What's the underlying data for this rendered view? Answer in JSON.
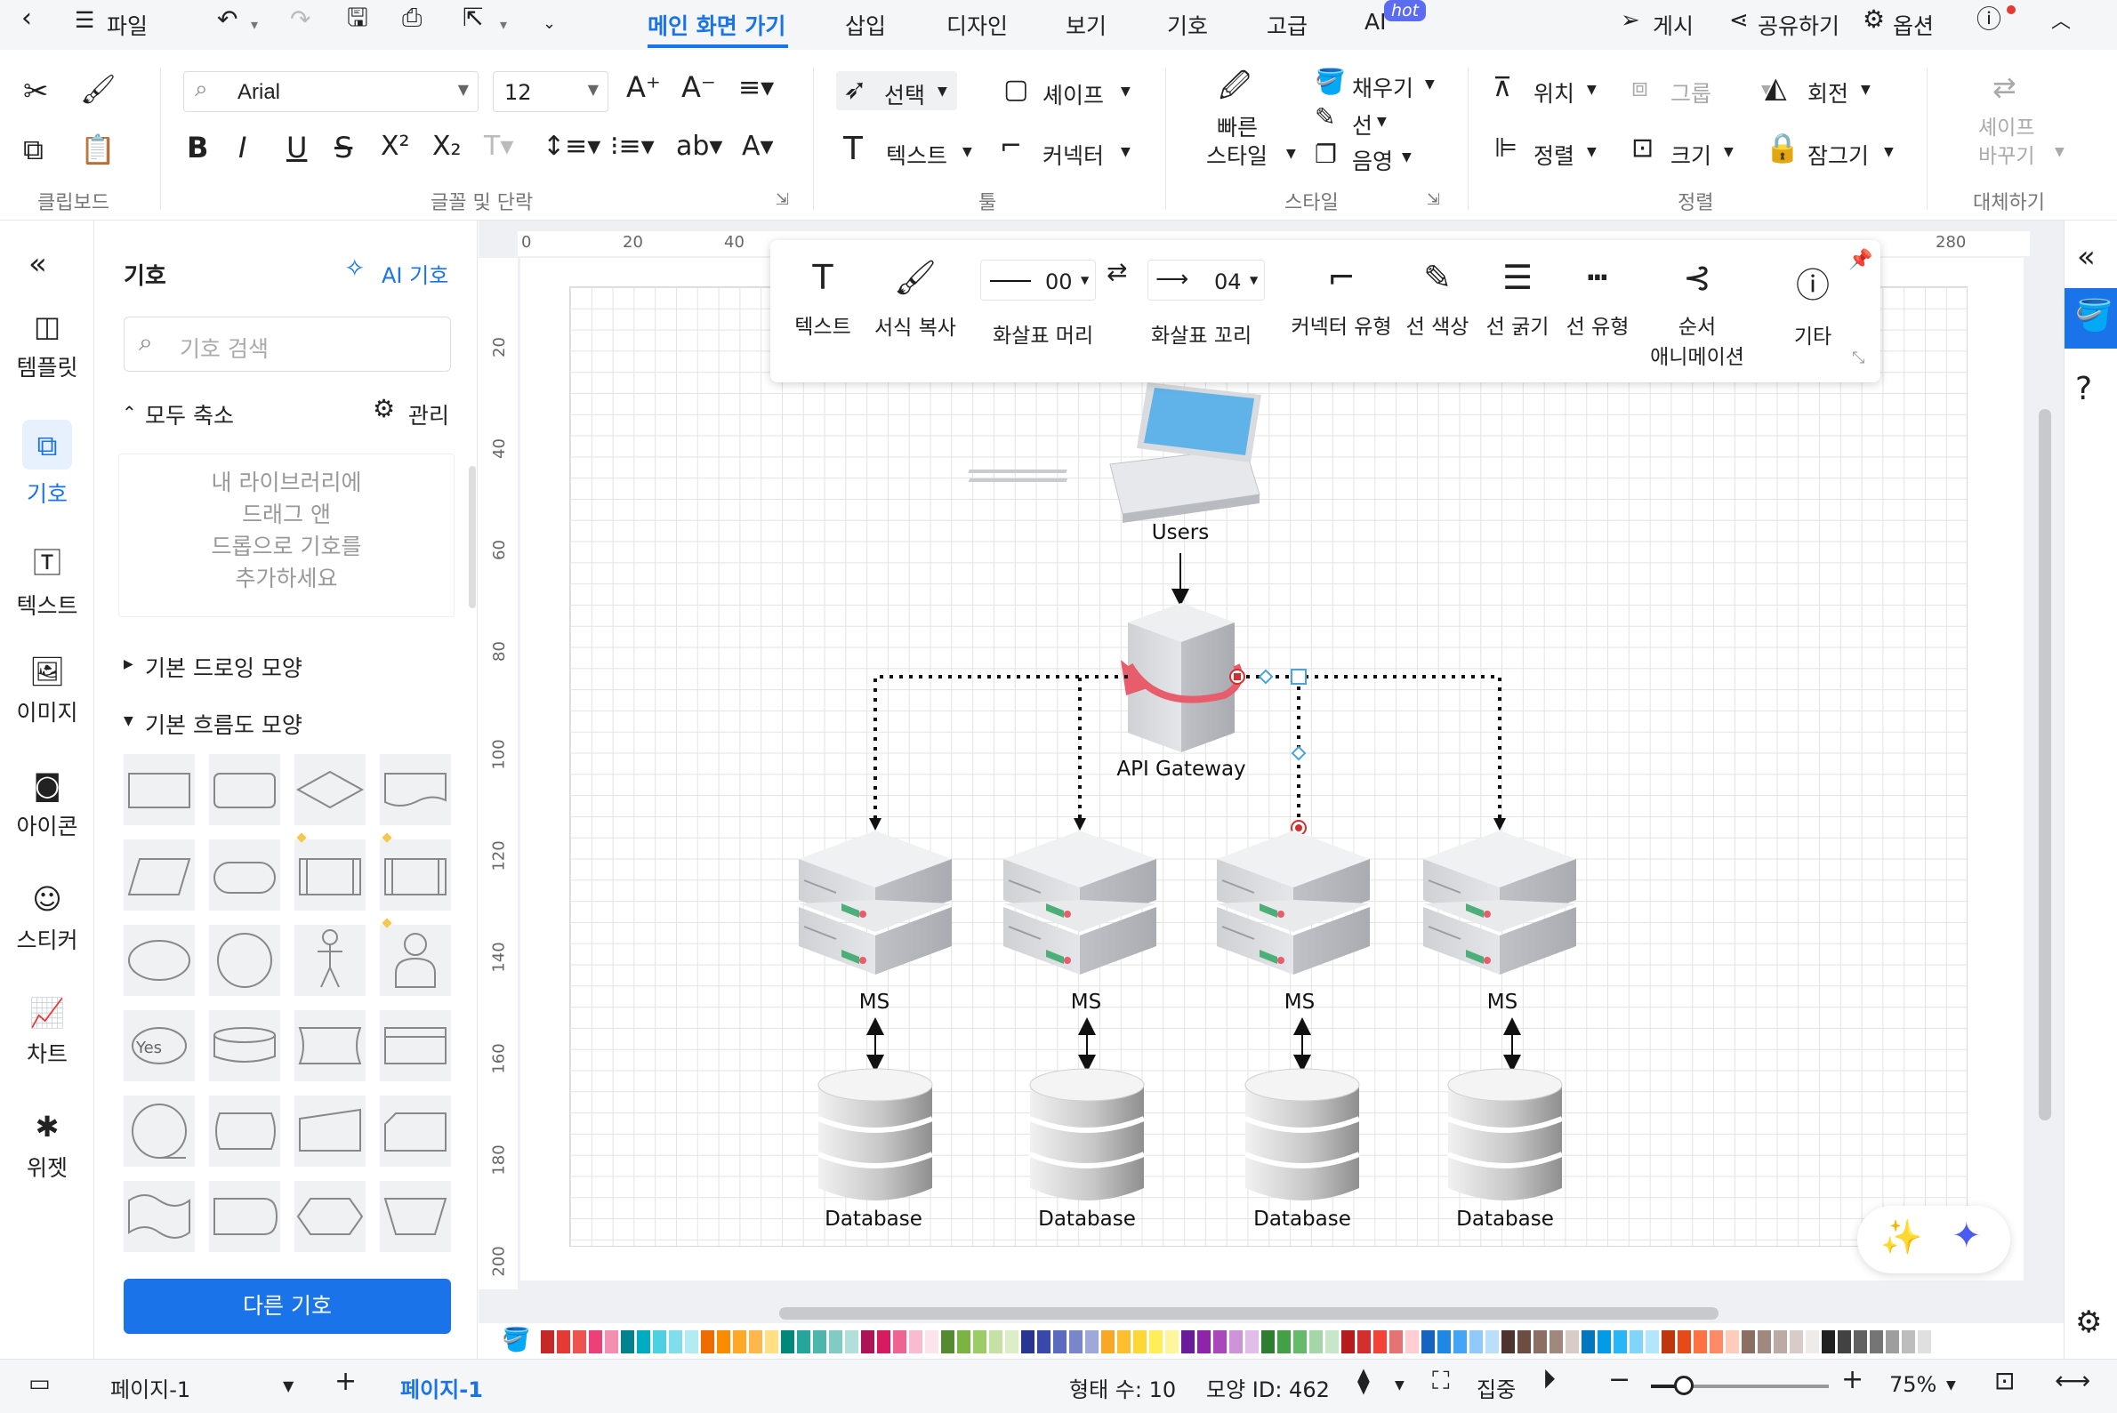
{
  "menubar": {
    "file": "파일",
    "tabs": [
      "메인 화면 가기",
      "삽입",
      "디자인",
      "보기",
      "기호",
      "고급",
      "AI"
    ],
    "hot_badge": "hot",
    "publish": "게시",
    "share": "공유하기",
    "options": "옵션"
  },
  "ribbon": {
    "font_name": "Arial",
    "font_size": "12",
    "select": "선택",
    "shape": "셰이프",
    "text": "텍스트",
    "connector": "커넥터",
    "quick_style_1": "빠른",
    "quick_style_2": "스타일",
    "fill": "채우기",
    "line": "선",
    "shadow": "음영",
    "position": "위치",
    "group": "그룹",
    "rotate": "회전",
    "align": "정렬",
    "size": "크기",
    "lock": "잠그기",
    "replace_1": "셰이프",
    "replace_2": "바꾸기",
    "groups": {
      "clipboard": "클립보드",
      "font": "글꼴 및 단락",
      "tools": "툴",
      "style": "스타일",
      "arrange": "정렬",
      "replace": "대체하기"
    }
  },
  "leftrail": [
    "템플릿",
    "기호",
    "텍스트",
    "이미지",
    "아이콘",
    "스티커",
    "차트",
    "위젯"
  ],
  "panel": {
    "title": "기호",
    "ai_link": "AI 기호",
    "search_placeholder": "기호 검색",
    "collapse_all": "모두 축소",
    "manage": "관리",
    "drop_hint_1": "내 라이브러리에",
    "drop_hint_2": "드래그 앤",
    "drop_hint_3": "드롭으로 기호를",
    "drop_hint_4": "추가하세요",
    "section_basic": "기본 드로잉 모양",
    "section_flow": "기본 흐름도 모양",
    "yes_label": "Yes",
    "more_button": "다른 기호"
  },
  "ruler": {
    "h": [
      "0",
      "20",
      "40",
      "280"
    ],
    "v": [
      "20",
      "40",
      "60",
      "80",
      "100",
      "120",
      "140",
      "160",
      "180",
      "200"
    ]
  },
  "floatbar": {
    "text": "텍스트",
    "format_copy": "서식 복사",
    "arrow_head_value": "00",
    "arrow_head": "화살표 머리",
    "arrow_tail_value": "04",
    "arrow_tail": "화살표 꼬리",
    "connector_type": "커넥터 유형",
    "line_color": "선 색상",
    "line_width": "선 굵기",
    "line_type": "선 유형",
    "sequence_1": "순서",
    "sequence_2": "애니메이션",
    "more": "기타"
  },
  "diagram": {
    "users": "Users",
    "gateway": "API Gateway",
    "ms": [
      "MS",
      "MS",
      "MS",
      "MS"
    ],
    "db": [
      "Database",
      "Database",
      "Database",
      "Database"
    ]
  },
  "status": {
    "page_selector": "페이지-1",
    "page_tab": "페이지-1",
    "shape_count": "형태 수: 10",
    "shape_id": "모양 ID: 462",
    "focus": "집중",
    "zoom": "75%"
  },
  "palette": [
    "#c62828",
    "#e53935",
    "#ef5350",
    "#ec407a",
    "#f48fb1",
    "#00838f",
    "#00acc1",
    "#4dd0e1",
    "#80deea",
    "#b2ebf2",
    "#ef6c00",
    "#fb8c00",
    "#ffa726",
    "#ffb74d",
    "#ffe082",
    "#00897b",
    "#26a69a",
    "#4db6ac",
    "#80cbc4",
    "#b2dfdb",
    "#ad1457",
    "#d81b60",
    "#f06292",
    "#f8bbd0",
    "#fce4ec",
    "#558b2f",
    "#7cb342",
    "#9ccc65",
    "#c5e1a5",
    "#dcedc8",
    "#283593",
    "#3949ab",
    "#5c6bc0",
    "#7986cb",
    "#9fa8da",
    "#f9a825",
    "#fbc02d",
    "#fdd835",
    "#ffee58",
    "#fff59d",
    "#6a1b9a",
    "#8e24aa",
    "#ab47bc",
    "#ce93d8",
    "#e1bee7",
    "#2e7d32",
    "#43a047",
    "#66bb6a",
    "#a5d6a7",
    "#c8e6c9",
    "#b71c1c",
    "#d32f2f",
    "#f44336",
    "#e57373",
    "#ffcdd2",
    "#1565c0",
    "#1e88e5",
    "#42a5f5",
    "#90caf9",
    "#bbdefb",
    "#4e342e",
    "#6d4c41",
    "#8d6e63",
    "#a1887f",
    "#d7ccc8",
    "#0277bd",
    "#039be5",
    "#29b6f6",
    "#81d4fa",
    "#b3e5fc",
    "#bf360c",
    "#e64a19",
    "#ff7043",
    "#ff8a65",
    "#ffccbc",
    "#8d6e63",
    "#a1887f",
    "#bcaaa4",
    "#d7ccc8",
    "#efebe9",
    "#212121",
    "#424242",
    "#616161",
    "#757575",
    "#9e9e9e",
    "#bdbdbd",
    "#e0e0e0"
  ]
}
